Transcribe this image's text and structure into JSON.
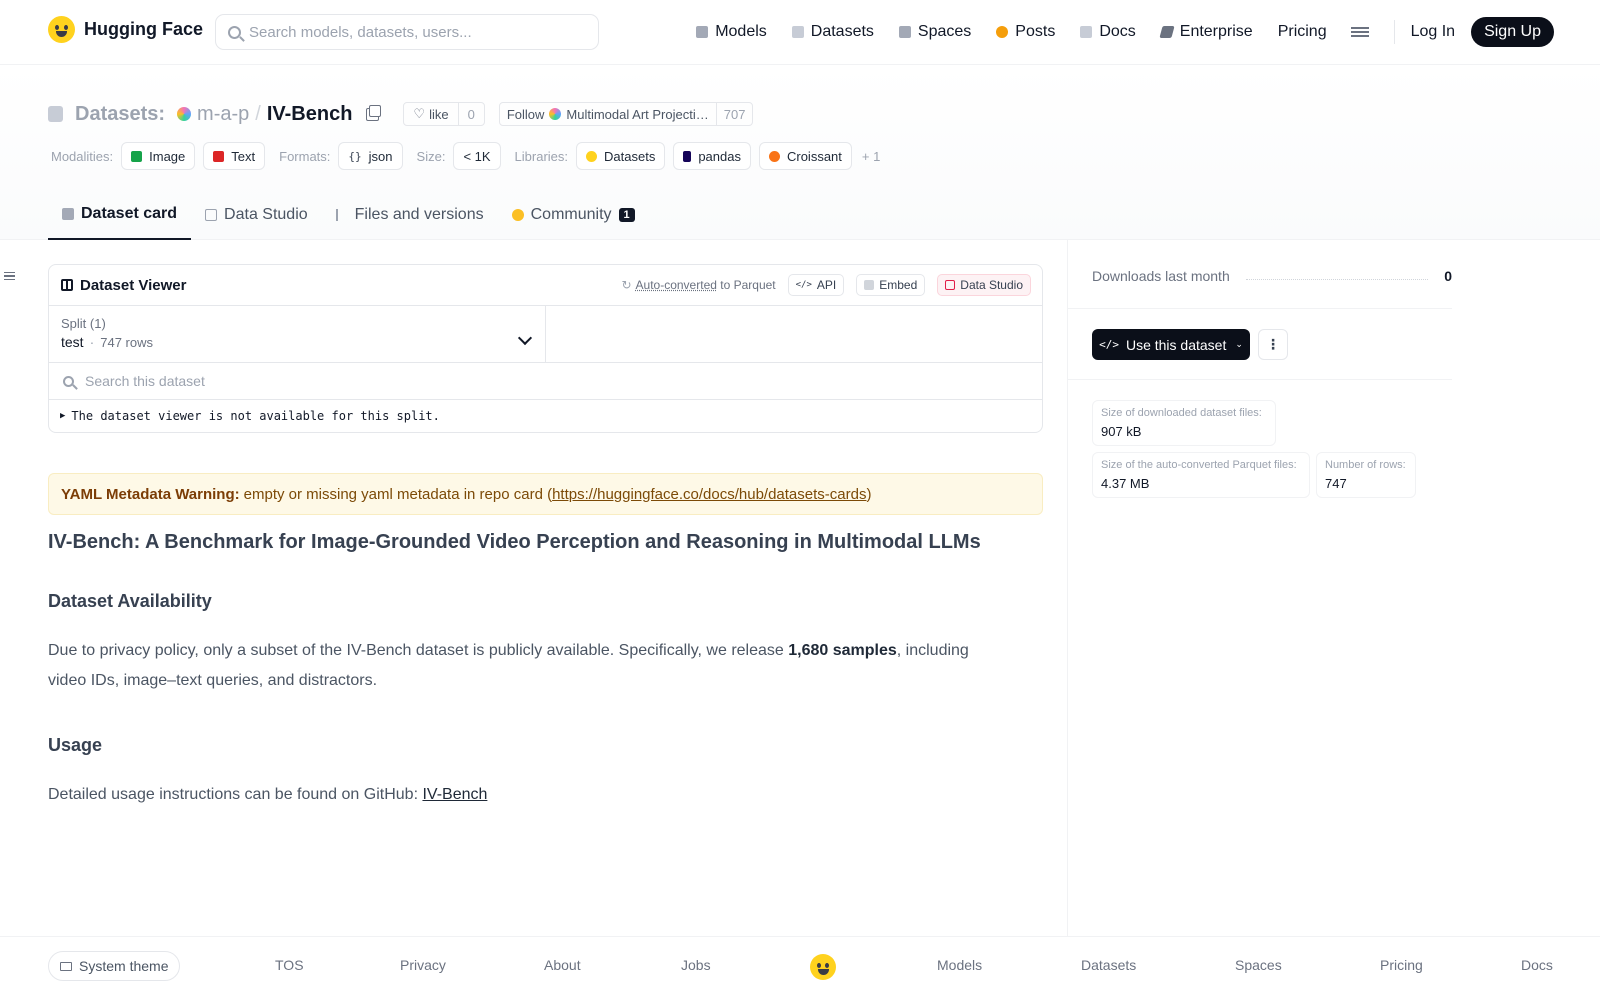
{
  "nav": {
    "brand": "Hugging Face",
    "search_placeholder": "Search models, datasets, users...",
    "links": [
      {
        "label": "Models",
        "color": "#a3a9b6"
      },
      {
        "label": "Datasets",
        "color": "#c7ccd6"
      },
      {
        "label": "Spaces",
        "color": "#a3a9b6"
      },
      {
        "label": "Posts",
        "color": "#f59e0b"
      },
      {
        "label": "Docs",
        "color": "#c7ccd6"
      },
      {
        "label": "Enterprise",
        "color": "#6b7280"
      },
      {
        "label": "Pricing",
        "color": ""
      }
    ],
    "login": "Log In",
    "signup": "Sign Up"
  },
  "header": {
    "crumb_label": "Datasets:",
    "org": "m-a-p",
    "separator": "/",
    "dataset": "IV-Bench",
    "like_label": "like",
    "like_count": "0",
    "follow_label": "Follow",
    "follow_org": "Multimodal Art Projecti…",
    "follow_count": "707",
    "modalities_label": "Modalities:",
    "modalities": [
      "Image",
      "Text"
    ],
    "formats_label": "Formats:",
    "formats": [
      "json"
    ],
    "size_label": "Size:",
    "size": "< 1K",
    "libraries_label": "Libraries:",
    "libraries": [
      "Datasets",
      "pandas",
      "Croissant"
    ],
    "more": "+ 1"
  },
  "tabs": [
    {
      "label": "Dataset card",
      "active": true
    },
    {
      "label": "Data Studio",
      "active": false
    },
    {
      "label": "Files and versions",
      "active": false
    },
    {
      "label": "Community",
      "active": false,
      "badge": "1"
    }
  ],
  "viewer": {
    "title": "Dataset Viewer",
    "autoconv_link": "Auto-converted",
    "autoconv_rest": " to Parquet",
    "api": "API",
    "embed": "Embed",
    "studio": "Data Studio",
    "split_label": "Split (1)",
    "split_name": "test",
    "split_dot": "·",
    "split_rows": "747 rows",
    "search_placeholder": "Search this dataset",
    "not_available": "The dataset viewer is not available for this split."
  },
  "warning": {
    "title": "YAML Metadata Warning:",
    "text": "empty or missing yaml metadata in repo card (",
    "link": "https://huggingface.co/docs/hub/datasets-cards",
    "close": ")"
  },
  "doc": {
    "h1": "IV-Bench: A Benchmark for Image-Grounded Video Perception and Reasoning in Multimodal LLMs",
    "availability_heading": "Dataset Availability",
    "availability_pre": "Due to privacy policy, only a subset of the IV-Bench dataset is publicly available. Specifically, we release ",
    "availability_bold": "1,680 samples",
    "availability_post": ", including video IDs, image–text queries, and distractors.",
    "usage_heading": "Usage",
    "usage_pre": "Detailed usage instructions can be found on GitHub: ",
    "usage_link": "IV-Bench"
  },
  "sidebar": {
    "downloads_label": "Downloads last month",
    "downloads_value": "0",
    "use_button": "Use this dataset",
    "stats": [
      {
        "label": "Size of downloaded dataset files:",
        "value": "907 kB"
      },
      {
        "label": "Size of the auto-converted Parquet files:",
        "value": "4.37 MB"
      },
      {
        "label": "Number of rows:",
        "value": "747"
      }
    ]
  },
  "footer": {
    "theme": "System theme",
    "links": [
      "TOS",
      "Privacy",
      "About",
      "Jobs",
      "Models",
      "Datasets",
      "Spaces",
      "Pricing",
      "Docs"
    ]
  }
}
